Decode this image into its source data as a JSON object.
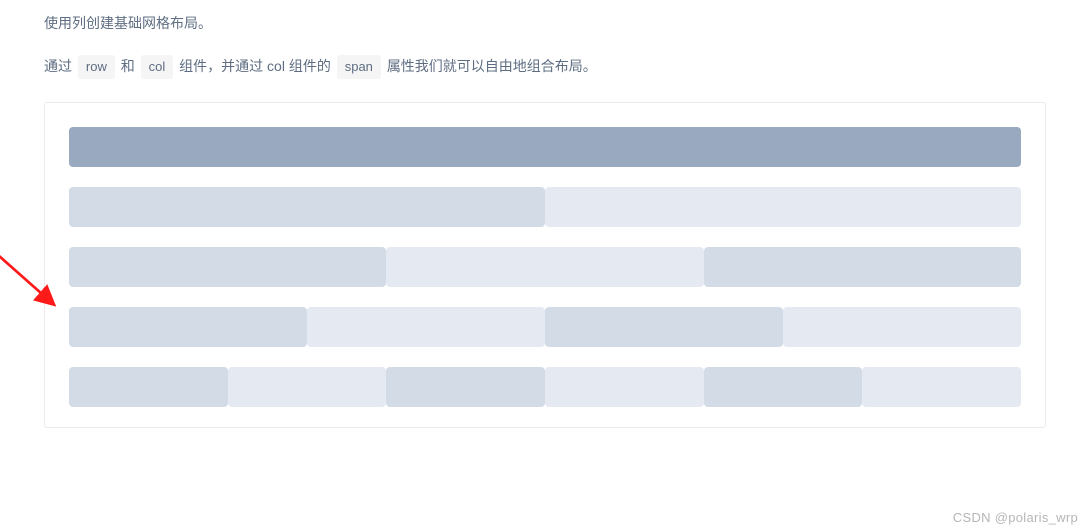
{
  "intro": "使用列创建基础网格布局。",
  "desc_parts": {
    "p1": "通过 ",
    "row": "row",
    "p2": " 和 ",
    "col": "col",
    "p3": " 组件，并通过 col 组件的 ",
    "span": "span",
    "p4": " 属性我们就可以自由地组合布局。"
  },
  "grid": {
    "rows": [
      {
        "cols": [
          {
            "span": 24,
            "shade": "dark"
          }
        ]
      },
      {
        "cols": [
          {
            "span": 12,
            "shade": "mid"
          },
          {
            "span": 12,
            "shade": "light"
          }
        ]
      },
      {
        "cols": [
          {
            "span": 8,
            "shade": "mid"
          },
          {
            "span": 8,
            "shade": "light"
          },
          {
            "span": 8,
            "shade": "mid"
          }
        ]
      },
      {
        "cols": [
          {
            "span": 6,
            "shade": "mid"
          },
          {
            "span": 6,
            "shade": "light"
          },
          {
            "span": 6,
            "shade": "mid"
          },
          {
            "span": 6,
            "shade": "light"
          }
        ]
      },
      {
        "cols": [
          {
            "span": 4,
            "shade": "mid"
          },
          {
            "span": 4,
            "shade": "light"
          },
          {
            "span": 4,
            "shade": "mid"
          },
          {
            "span": 4,
            "shade": "light"
          },
          {
            "span": 4,
            "shade": "mid"
          },
          {
            "span": 4,
            "shade": "light"
          }
        ]
      }
    ]
  },
  "colors": {
    "dark": "#99a9bf",
    "mid": "#d3dce6",
    "light": "#e5e9f2"
  },
  "watermark": "CSDN @polaris_wrp"
}
